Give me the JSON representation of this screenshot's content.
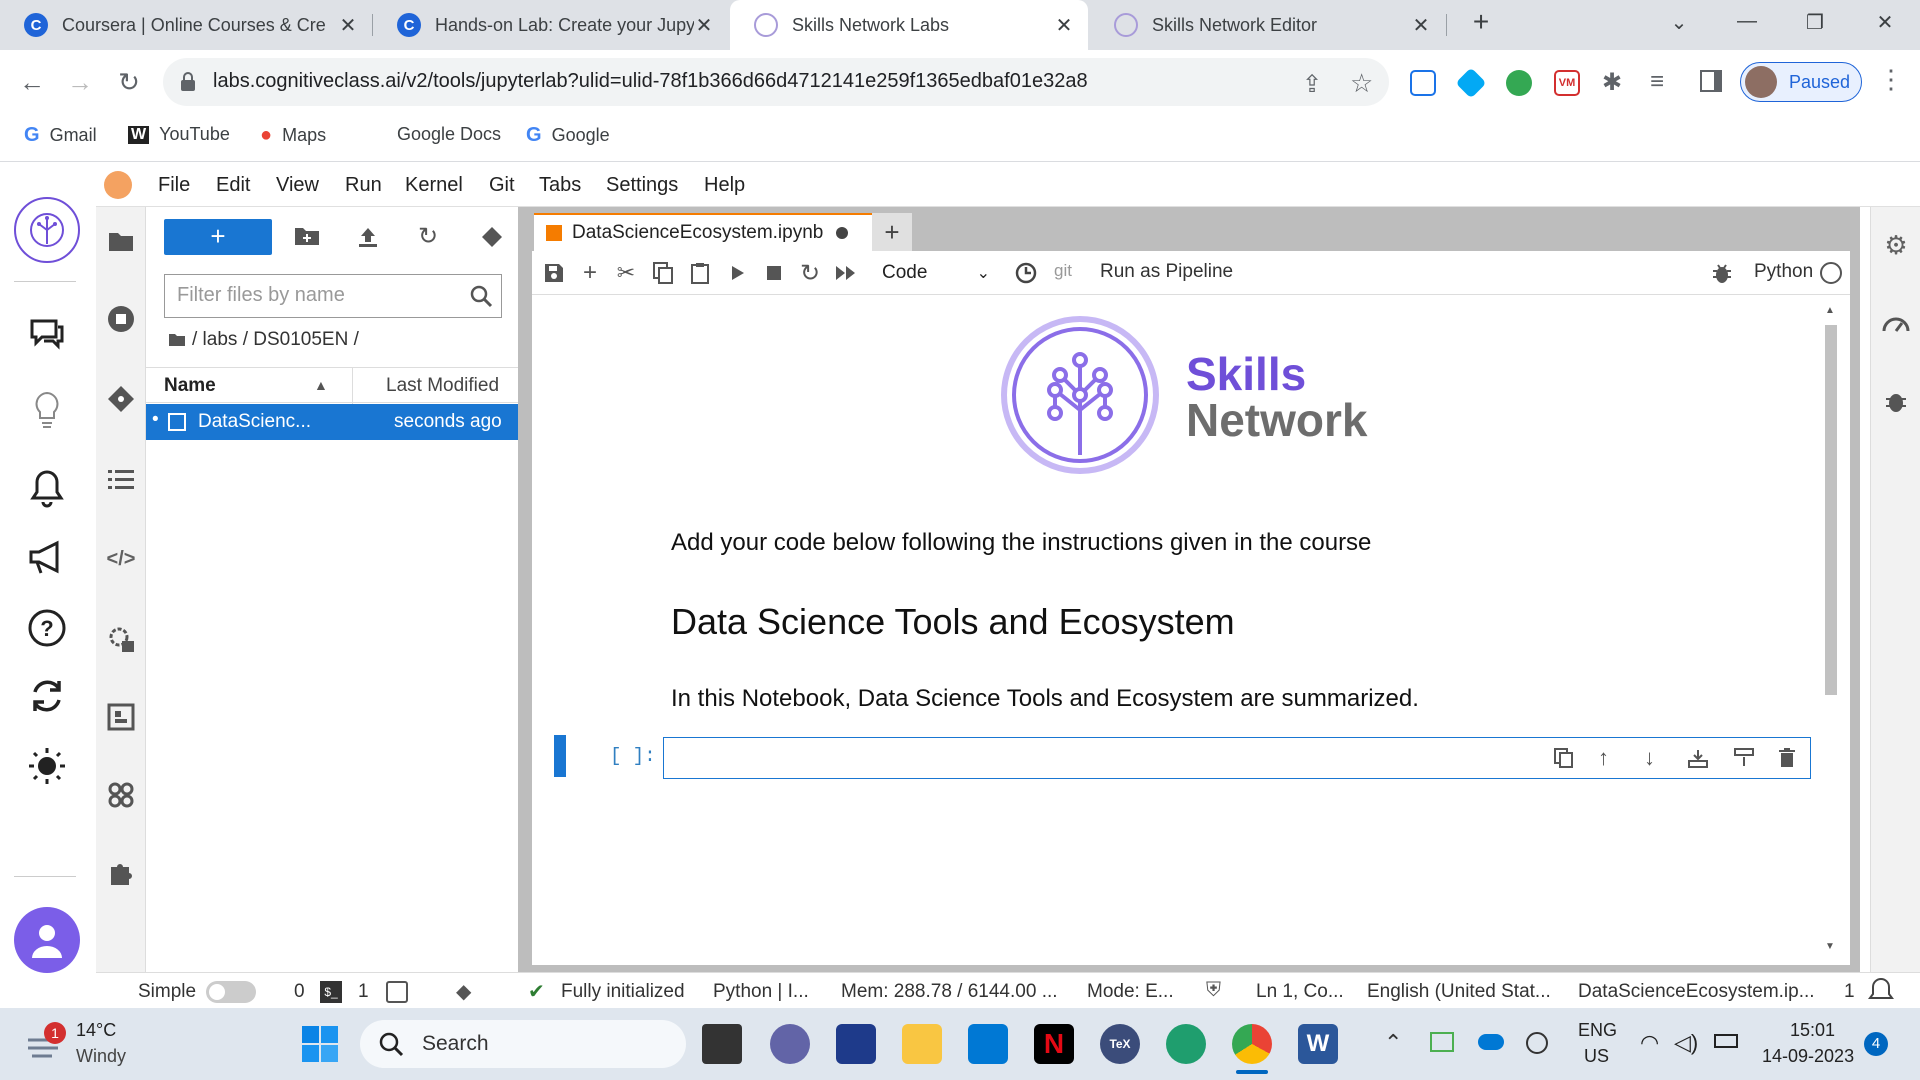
{
  "browser": {
    "tabs": [
      {
        "label": "Coursera | Online Courses & Cre",
        "favicon": "C",
        "active": false
      },
      {
        "label": "Hands-on Lab: Create your Jupyt",
        "favicon": "C",
        "active": false
      },
      {
        "label": "Skills Network Labs",
        "favicon": "sn",
        "active": true
      },
      {
        "label": "Skills Network Editor",
        "favicon": "sn",
        "active": false
      }
    ],
    "url": "labs.cognitiveclass.ai/v2/tools/jupyterlab?ulid=ulid-78f1b366d66d4712141e259f1365edbaf01e32a8",
    "profile_status": "Paused",
    "bookmarks": [
      {
        "label": "Gmail",
        "icon": "G"
      },
      {
        "label": "YouTube",
        "icon": "W"
      },
      {
        "label": "Maps",
        "icon": "pin"
      },
      {
        "label": "Google Docs",
        "icon": ""
      },
      {
        "label": "Google",
        "icon": "G"
      }
    ]
  },
  "jupyter": {
    "menu": [
      "File",
      "Edit",
      "View",
      "Run",
      "Kernel",
      "Git",
      "Tabs",
      "Settings",
      "Help"
    ],
    "filebrowser": {
      "new_label": "+",
      "filter_placeholder": "Filter files by name",
      "breadcrumb": "/ labs / DS0105EN /",
      "col_name": "Name",
      "col_modified": "Last Modified",
      "files": [
        {
          "name": "DataScienc...",
          "modified": "seconds ago"
        }
      ]
    },
    "notebook": {
      "tab_label": "DataScienceEcosystem.ipynb",
      "cell_type": "Code",
      "git_label": "git",
      "pipeline_label": "Run as Pipeline",
      "kernel_name": "Python",
      "logo_line1": "Skills",
      "logo_line2": "Network",
      "intro_text": "Add your code below following the instructions given in the course",
      "heading": "Data Science Tools and Ecosystem",
      "summary": "In this Notebook, Data Science Tools and Ecosystem are summarized.",
      "prompt": "[ ]:"
    },
    "status": {
      "simple": "Simple",
      "count_a": "0",
      "count_b": "1",
      "init": "Fully initialized",
      "kernel": "Python | I...",
      "mem": "Mem: 288.78 / 6144.00 ...",
      "mode": "Mode: E...",
      "lncol": "Ln 1, Co...",
      "lang": "English (United Stat...",
      "file": "DataScienceEcosystem.ip...",
      "notif": "1"
    }
  },
  "taskbar": {
    "weather_temp": "14°C",
    "weather_desc": "Windy",
    "weather_badge": "1",
    "search_label": "Search",
    "lang_line1": "ENG",
    "lang_line2": "US",
    "time": "15:01",
    "date": "14-09-2023",
    "notif_count": "4"
  },
  "colors": {
    "accent_blue": "#1976d2",
    "sn_purple": "#6f4fd8",
    "chrome_bg": "#dee1e6",
    "taskbar_bg": "#dfe6ee"
  }
}
